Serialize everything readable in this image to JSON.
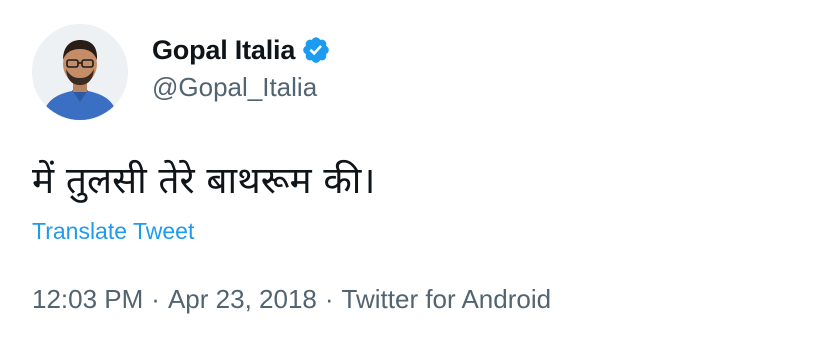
{
  "author": {
    "display_name": "Gopal Italia",
    "handle": "@Gopal_Italia",
    "verified": true,
    "avatar_icon": "profile-photo"
  },
  "tweet": {
    "text": "में तुलसी तेरे बाथरूम की।",
    "translate_label": "Translate Tweet",
    "time": "12:03 PM",
    "date": "Apr 23, 2018",
    "source": "Twitter for Android",
    "separator": "·"
  },
  "colors": {
    "link": "#1d9bf0",
    "secondary_text": "#536471",
    "primary_text": "#0f1419",
    "verified_badge": "#1d9bf0"
  }
}
